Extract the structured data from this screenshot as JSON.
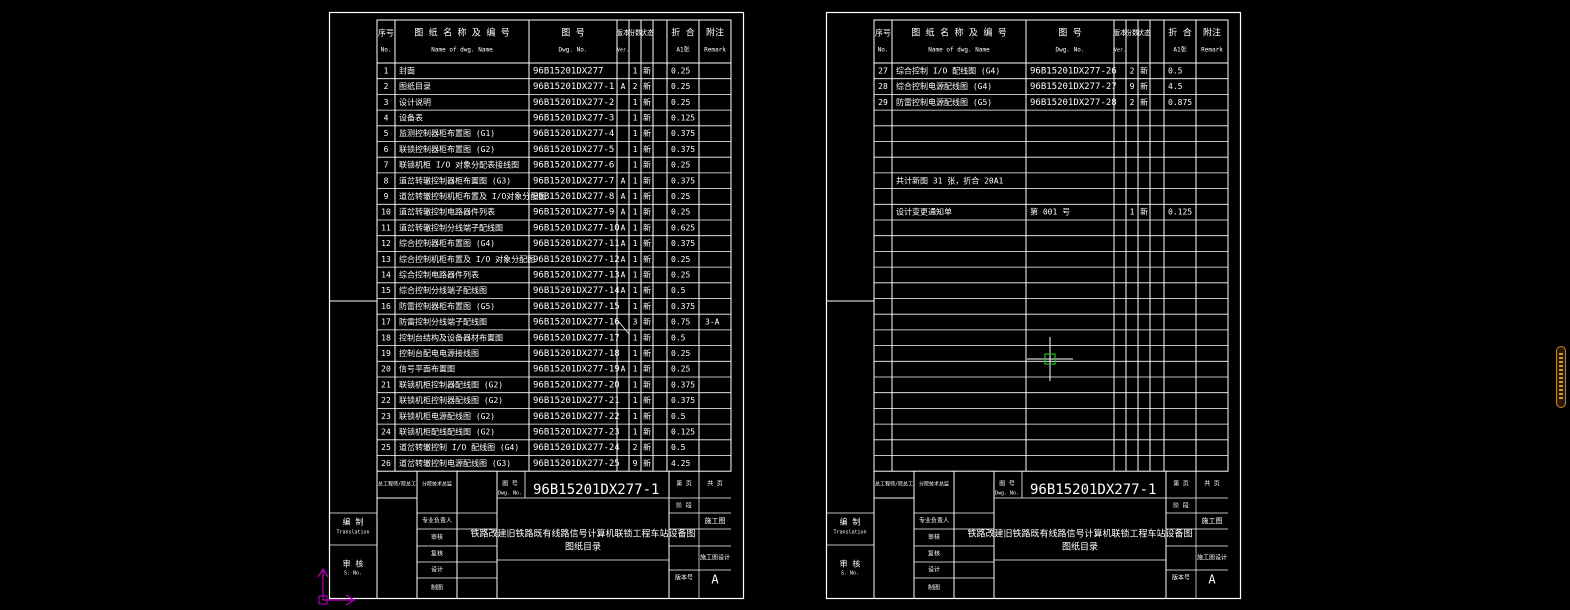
{
  "sheet1": {
    "header": {
      "no": "序号",
      "no_en": "No.",
      "name": "图 纸 名 称 及 编 号",
      "name_en": "Name of dwg. Name",
      "dwg": "图  号",
      "dwg_en": "Dwg. No.",
      "ver": "版本",
      "ver_en": "Ver.",
      "copies": "份数",
      "copies_en": "Copies",
      "status": "状态",
      "size": "折 合",
      "size_sub": "A1张",
      "remark": "附注",
      "remark_en": "Remark"
    },
    "rows": [
      {
        "no": "1",
        "name": "封面",
        "dwg": "96B15201DX277",
        "ver": "",
        "copies": "1",
        "status": "新",
        "size": "0.25",
        "remark": ""
      },
      {
        "no": "2",
        "name": "图纸目录",
        "dwg": "96B15201DX277-1",
        "ver": "A",
        "copies": "2",
        "status": "新",
        "size": "0.25",
        "remark": ""
      },
      {
        "no": "3",
        "name": "设计说明",
        "dwg": "96B15201DX277-2",
        "ver": "",
        "copies": "1",
        "status": "新",
        "size": "0.25",
        "remark": ""
      },
      {
        "no": "4",
        "name": "设备表",
        "dwg": "96B15201DX277-3",
        "ver": "",
        "copies": "1",
        "status": "新",
        "size": "0.125",
        "remark": ""
      },
      {
        "no": "5",
        "name": "监测控制器柜布置图 (G1)",
        "dwg": "96B15201DX277-4",
        "ver": "",
        "copies": "1",
        "status": "新",
        "size": "0.375",
        "remark": ""
      },
      {
        "no": "6",
        "name": "联锁控制器柜布置图 (G2)",
        "dwg": "96B15201DX277-5",
        "ver": "",
        "copies": "1",
        "status": "新",
        "size": "0.375",
        "remark": ""
      },
      {
        "no": "7",
        "name": "联锁机柜 I/O 对象分配表接线图",
        "dwg": "96B15201DX277-6",
        "ver": "",
        "copies": "1",
        "status": "新",
        "size": "0.25",
        "remark": ""
      },
      {
        "no": "8",
        "name": "道岔转辙控制器柜布置图 (G3)",
        "dwg": "96B15201DX277-7",
        "ver": "A",
        "copies": "1",
        "status": "新",
        "size": "0.375",
        "remark": ""
      },
      {
        "no": "9",
        "name": "道岔转辙控制机柜布置及 I/O对象分配图",
        "dwg": "96B15201DX277-8",
        "ver": "A",
        "copies": "1",
        "status": "新",
        "size": "0.25",
        "remark": ""
      },
      {
        "no": "10",
        "name": "道岔转辙控制电路器件列表",
        "dwg": "96B15201DX277-9",
        "ver": "A",
        "copies": "1",
        "status": "新",
        "size": "0.25",
        "remark": ""
      },
      {
        "no": "11",
        "name": "道岔转辙控制分线端子配线图",
        "dwg": "96B15201DX277-10",
        "ver": "A",
        "copies": "1",
        "status": "新",
        "size": "0.625",
        "remark": ""
      },
      {
        "no": "12",
        "name": "综合控制器柜布置图 (G4)",
        "dwg": "96B15201DX277-11",
        "ver": "A",
        "copies": "1",
        "status": "新",
        "size": "0.375",
        "remark": ""
      },
      {
        "no": "13",
        "name": "综合控制机柜布置及 I/O 对象分配图",
        "dwg": "96B15201DX277-12",
        "ver": "A",
        "copies": "1",
        "status": "新",
        "size": "0.25",
        "remark": ""
      },
      {
        "no": "14",
        "name": "综合控制电路器件列表",
        "dwg": "96B15201DX277-13",
        "ver": "A",
        "copies": "1",
        "status": "新",
        "size": "0.25",
        "remark": ""
      },
      {
        "no": "15",
        "name": "综合控制分线端子配线图",
        "dwg": "96B15201DX277-14",
        "ver": "A",
        "copies": "1",
        "status": "新",
        "size": "0.5",
        "remark": ""
      },
      {
        "no": "16",
        "name": "防雷控制器柜布置图 (G5)",
        "dwg": "96B15201DX277-15",
        "ver": "",
        "copies": "1",
        "status": "新",
        "size": "0.375",
        "remark": ""
      },
      {
        "no": "17",
        "name": "防雷控制分线端子配线图",
        "dwg": "96B15201DX277-16",
        "ver": "",
        "copies": "3",
        "status": "新",
        "size": "0.75",
        "remark": "3-A"
      },
      {
        "no": "18",
        "name": "控制台结构及设备器材布置图",
        "dwg": "96B15201DX277-17",
        "ver": "",
        "copies": "1",
        "status": "新",
        "size": "0.5",
        "remark": ""
      },
      {
        "no": "19",
        "name": "控制台配电电源接线图",
        "dwg": "96B15201DX277-18",
        "ver": "",
        "copies": "1",
        "status": "新",
        "size": "0.25",
        "remark": ""
      },
      {
        "no": "20",
        "name": "信号平面布置图",
        "dwg": "96B15201DX277-19",
        "ver": "A",
        "copies": "1",
        "status": "新",
        "size": "0.25",
        "remark": ""
      },
      {
        "no": "21",
        "name": "联锁机柜控制器配线图    (G2)",
        "dwg": "96B15201DX277-20",
        "ver": "",
        "copies": "1",
        "status": "新",
        "size": "0.375",
        "remark": ""
      },
      {
        "no": "22",
        "name": "联锁机柜控制器配线图    (G2)",
        "dwg": "96B15201DX277-21",
        "ver": "",
        "copies": "1",
        "status": "新",
        "size": "0.375",
        "remark": ""
      },
      {
        "no": "23",
        "name": "联锁机柜电源配线图    (G2)",
        "dwg": "96B15201DX277-22",
        "ver": "",
        "copies": "1",
        "status": "新",
        "size": "0.5",
        "remark": ""
      },
      {
        "no": "24",
        "name": "联锁机柜配线配线图    (G2)",
        "dwg": "96B15201DX277-23",
        "ver": "",
        "copies": "1",
        "status": "新",
        "size": "0.125",
        "remark": ""
      },
      {
        "no": "25",
        "name": "道岔转辙控制 I/O 配线图 (G4)",
        "dwg": "96B15201DX277-24",
        "ver": "",
        "copies": "2",
        "status": "新",
        "size": "0.5",
        "remark": ""
      },
      {
        "no": "26",
        "name": "道岔转辙控制电源配线图 (G3)",
        "dwg": "96B15201DX277-25",
        "ver": "",
        "copies": "9",
        "status": "新",
        "size": "4.25",
        "remark": ""
      }
    ],
    "title_block": {
      "drawing_no_label": "图 号",
      "drawing_no_label_en": "Dwg. No.",
      "drawing_no": "96B15201DX277-1",
      "stage_label": "阶 段",
      "stage": "施工图",
      "title": "铁路改建旧铁路既有线路信号计算机联锁工程车站设备图",
      "subtitle": "图纸目录",
      "version_label": "版本号",
      "version": "A",
      "page_label": "第 页",
      "total_label": "共 页",
      "dept": "施工图设计",
      "left_labels": [
        "编 制",
        "审 核"
      ],
      "left_labels_en": [
        "Translation",
        "S. No."
      ],
      "sign_labels": [
        "总工程师/院总工",
        "分院技术总监",
        "专业负责人",
        "审核",
        "复核",
        "设计",
        "制图"
      ],
      "sign_labels_en": [
        "Chief Engineer",
        "Approved",
        "Checked",
        "Checked",
        "Checked",
        "Designed",
        "Drawn"
      ]
    }
  },
  "sheet2": {
    "rows": [
      {
        "no": "27",
        "name": "综合控制 I/O 配线图    (G4)",
        "dwg": "96B15201DX277-26",
        "ver": "",
        "copies": "2",
        "status": "新",
        "size": "0.5",
        "remark": ""
      },
      {
        "no": "28",
        "name": "综合控制电源配线图 (G4)",
        "dwg": "96B15201DX277-27",
        "ver": "",
        "copies": "9",
        "status": "新",
        "size": "4.5",
        "remark": ""
      },
      {
        "no": "29",
        "name": "防雷控制电源配线图 (G5)",
        "dwg": "96B15201DX277-28",
        "ver": "",
        "copies": "2",
        "status": "新",
        "size": "0.875",
        "remark": ""
      }
    ],
    "total_text": "共计新图 31 张，折合 20A1",
    "change_row": {
      "name": "设计变更通知单",
      "dwg": "第 001 号",
      "copies": "1",
      "status": "新",
      "size": "0.125"
    },
    "title_block": {
      "drawing_no": "96B15201DX277-1",
      "stage": "施工图",
      "title": "铁路改建旧铁路既有线路信号计算机联锁工程车站设备图",
      "subtitle": "图纸目录",
      "version": "A",
      "dept": "施工图设计"
    }
  },
  "colors": {
    "background": "#000000",
    "lines": "#ffffff",
    "ucs_icon": "#c000c0",
    "cursor_box": "#20c020",
    "scrollbar": "#c58a2a"
  }
}
